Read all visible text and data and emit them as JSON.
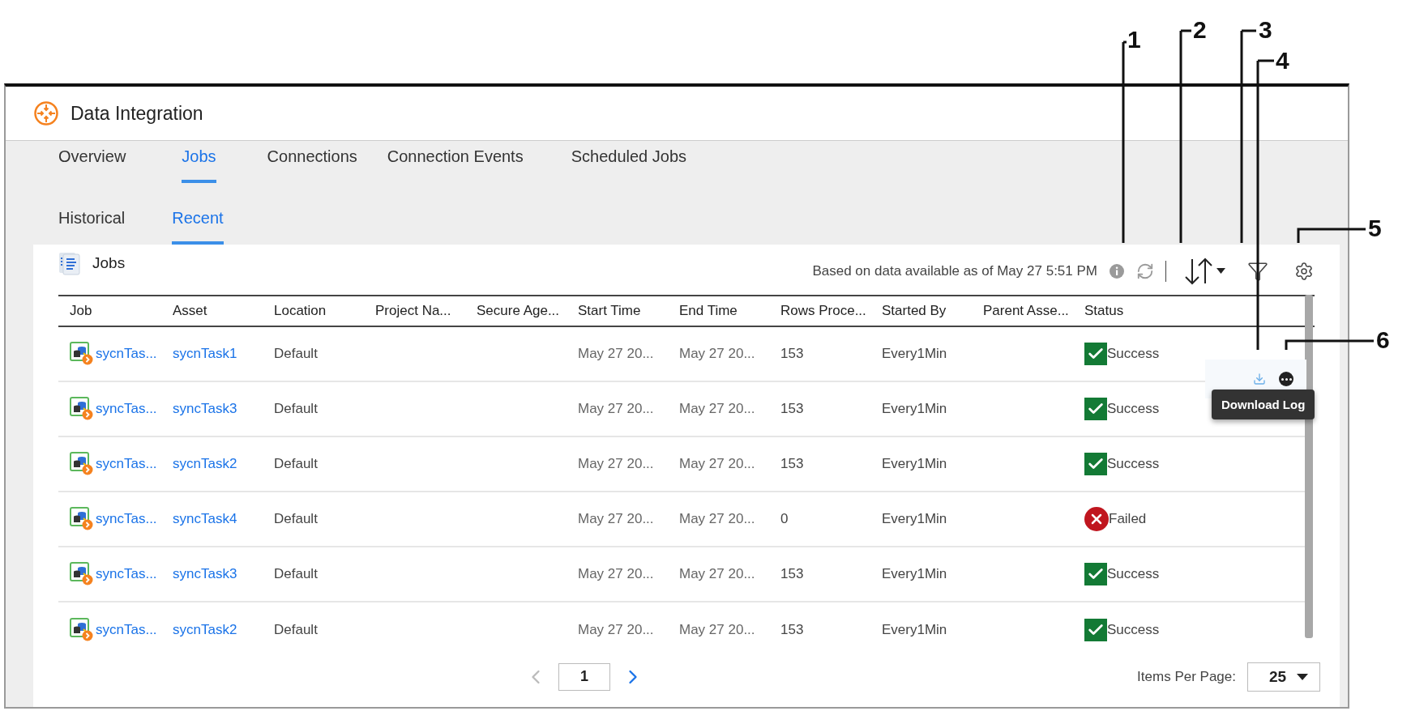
{
  "app": {
    "title": "Data Integration"
  },
  "tabs": [
    {
      "label": "Overview",
      "selected": false
    },
    {
      "label": "Jobs",
      "selected": true
    },
    {
      "label": "Connections",
      "selected": false
    },
    {
      "label": "Connection Events",
      "selected": false
    },
    {
      "label": "Scheduled Jobs",
      "selected": false
    }
  ],
  "subtabs": [
    {
      "label": "Historical",
      "selected": false
    },
    {
      "label": "Recent",
      "selected": true
    }
  ],
  "panel": {
    "title": "Jobs",
    "data_note": "Based on data available as of May 27 5:51 PM"
  },
  "table": {
    "columns": [
      "Job",
      "Asset",
      "Location",
      "Project Na...",
      "Secure Age...",
      "Start Time",
      "End Time",
      "Rows Proce...",
      "Started By",
      "Parent Asse...",
      "Status"
    ],
    "rows": [
      {
        "job": "sycnTas...",
        "asset": "sycnTask1",
        "location": "Default",
        "start_time": "May 27 20...",
        "end_time": "May 27 20...",
        "rows_processed": "153",
        "started_by": "Every1Min",
        "status": "Success",
        "kind": "success"
      },
      {
        "job": "syncTas...",
        "asset": "syncTask3",
        "location": "Default",
        "start_time": "May 27 20...",
        "end_time": "May 27 20...",
        "rows_processed": "153",
        "started_by": "Every1Min",
        "status": "Success",
        "kind": "success"
      },
      {
        "job": "sycnTas...",
        "asset": "sycnTask2",
        "location": "Default",
        "start_time": "May 27 20...",
        "end_time": "May 27 20...",
        "rows_processed": "153",
        "started_by": "Every1Min",
        "status": "Success",
        "kind": "success"
      },
      {
        "job": "syncTas...",
        "asset": "syncTask4",
        "location": "Default",
        "start_time": "May 27 20...",
        "end_time": "May 27 20...",
        "rows_processed": "0",
        "started_by": "Every1Min",
        "status": "Failed",
        "kind": "failed"
      },
      {
        "job": "syncTas...",
        "asset": "syncTask3",
        "location": "Default",
        "start_time": "May 27 20...",
        "end_time": "May 27 20...",
        "rows_processed": "153",
        "started_by": "Every1Min",
        "status": "Success",
        "kind": "success"
      },
      {
        "job": "sycnTas...",
        "asset": "sycnTask2",
        "location": "Default",
        "start_time": "May 27 20...",
        "end_time": "May 27 20...",
        "rows_processed": "153",
        "started_by": "Every1Min",
        "status": "Success",
        "kind": "success"
      }
    ]
  },
  "row_actions": {
    "tooltip": "Download Log"
  },
  "pagination": {
    "page": "1",
    "items_per_page_label": "Items Per Page:",
    "items_per_page": "25"
  },
  "callouts": [
    {
      "label": "1"
    },
    {
      "label": "2"
    },
    {
      "label": "3"
    },
    {
      "label": "4"
    },
    {
      "label": "5"
    },
    {
      "label": "6"
    }
  ]
}
